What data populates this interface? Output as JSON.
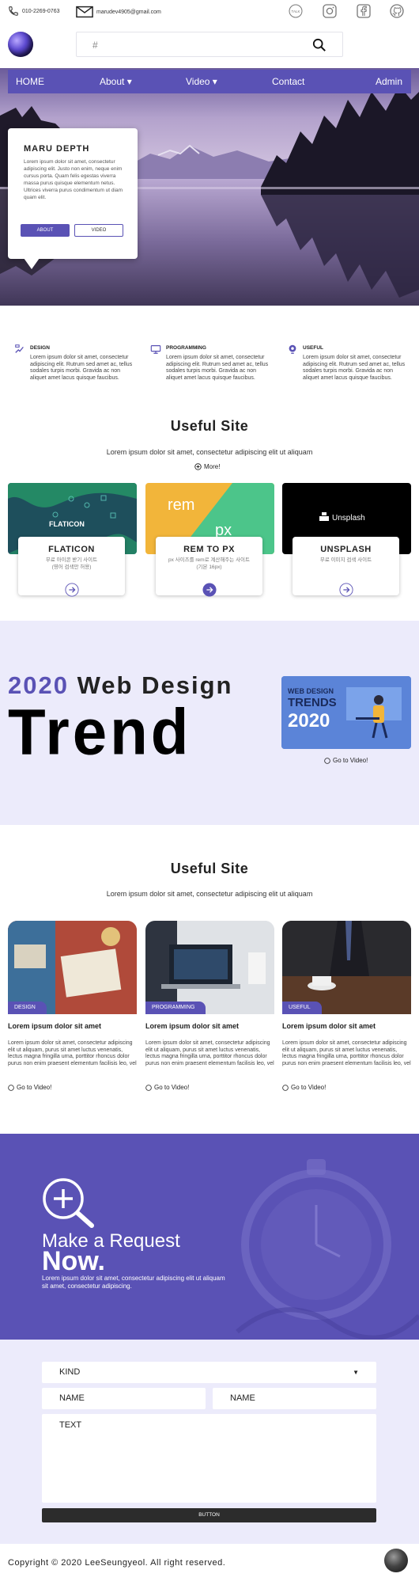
{
  "header": {
    "phone": "010-2269-0763",
    "email": "marudev4905@gmail.com",
    "social_icons": [
      "talk-icon",
      "instagram-icon",
      "facebook-icon",
      "github-icon"
    ],
    "social_labels": {
      "talk": "TALK"
    },
    "search_placeholder": "#"
  },
  "nav": {
    "home": "HOME",
    "about": "About ▾",
    "video": "Video ▾",
    "contact": "Contact",
    "admin": "Admin"
  },
  "hero": {
    "title": "MARU DEPTH",
    "text": "Lorem ipsum dolor sit amet, consectetur adipiscing elit. Justo non enim, neque enim cursus porta. Quam felis egestas viverra massa purus quisque elementum netus. Ultrices viverra purus condimentum ut diam quam elit.",
    "about_button": "ABOUT",
    "video_button": "VIDEO"
  },
  "features": [
    {
      "title": "DESIGN",
      "text": "Lorem ipsum dolor sit amet, consectetur adipiscing elit. Rutrum sed amet ac, tellus sodales turpis morbi. Gravida ac non aliquet amet lacus quisque faucibus."
    },
    {
      "title": "PROGRAMMING",
      "text": "Lorem ipsum dolor sit amet, consectetur adipiscing elit. Rutrum sed amet ac, tellus sodales turpis morbi. Gravida ac non aliquet amet lacus quisque faucibus."
    },
    {
      "title": "USEFUL",
      "text": "Lorem ipsum dolor sit amet, consectetur adipiscing elit. Rutrum sed amet ac, tellus sodales turpis morbi. Gravida ac non aliquet amet lacus quisque faucibus."
    }
  ],
  "useful1": {
    "title": "Useful Site",
    "subtitle": "Lorem ipsum dolor sit amet, consectetur adipiscing elit ut aliquam",
    "more": "More!",
    "sites": [
      {
        "name": "FLATICON",
        "desc": "무료 아이콘 받기 사이트\n(영어 검색만 허용)",
        "logo_text": "FLATICON"
      },
      {
        "name": "REM TO PX",
        "desc": "px 사이즈를 rem로 계산해주는 사이트\n(기본 16px)",
        "logo_a": "rem",
        "logo_b": "px"
      },
      {
        "name": "UNSPLASH",
        "desc": "무료 이미지 검색 사이트",
        "logo_text": "Unsplash"
      }
    ]
  },
  "trend": {
    "year": "2020",
    "line1": "Web Design",
    "big": "Trend",
    "thumb_l1": "WEB DESIGN",
    "thumb_l2": "TRENDS",
    "thumb_l3": "2020",
    "go": "Go to Video!"
  },
  "useful2": {
    "title": "Useful Site",
    "subtitle": "Lorem ipsum dolor sit amet, consectetur adipiscing elit ut aliquam",
    "articles": [
      {
        "tag": "DESIGN",
        "title": "Lorem ipsum dolor sit amet",
        "text": "Lorem ipsum dolor sit amet, consectetur adipiscing elit ut aliquam, purus sit amet luctus venenatis, lectus magna fringilla urna, porttitor rhoncus dolor purus non enim praesent elementum facilisis leo, vel",
        "go": "Go to Video!"
      },
      {
        "tag": "PROGRAMMING",
        "title": "Lorem ipsum dolor sit amet",
        "text": "Lorem ipsum dolor sit amet, consectetur adipiscing elit ut aliquam, purus sit amet luctus venenatis, lectus magna fringilla urna, porttitor rhoncus dolor purus non enim praesent elementum facilisis leo, vel",
        "go": "Go to Video!"
      },
      {
        "tag": "USEFUL",
        "title": "Lorem ipsum dolor sit amet",
        "text": "Lorem ipsum dolor sit amet, consectetur adipiscing elit ut aliquam, purus sit amet luctus venenatis, lectus magna fringilla urna, porttitor rhoncus dolor purus non enim praesent elementum facilisis leo, vel",
        "go": "Go to Video!"
      }
    ]
  },
  "request": {
    "line1": "Make a Request",
    "line2": "Now.",
    "text": "Lorem ipsum dolor sit amet, consectetur adipiscing elit ut aliquam sit amet, consectetur adipiscing."
  },
  "form": {
    "kind": "KIND",
    "name1": "NAME",
    "name2": "NAME",
    "text": "TEXT",
    "button": "BUTTON"
  },
  "footer": {
    "copyright": "Copyright © 2020 LeeSeungyeol. All right reserved."
  },
  "colors": {
    "accent": "#5a52b5",
    "light_bg": "#ecebfb",
    "dark": "#2c2c2c"
  }
}
